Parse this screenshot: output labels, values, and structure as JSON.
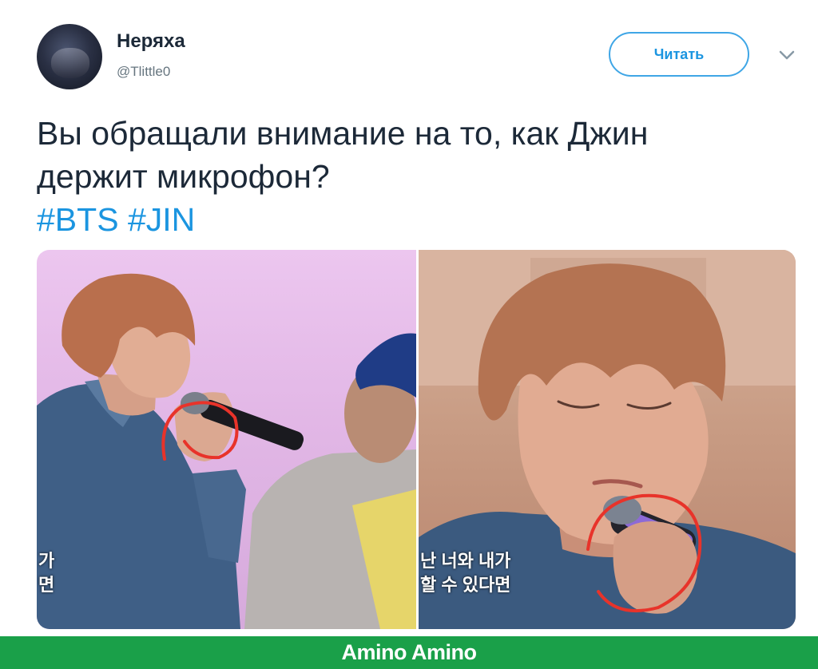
{
  "tweet": {
    "author_name": "Неряха",
    "author_handle": "@Tlittle0",
    "follow_label": "Читать",
    "text_line1": "Вы обращали внимание на то, как Джин",
    "text_line2": "держит микрофон?",
    "hashtags": [
      "#BTS",
      "#JIN"
    ]
  },
  "media": {
    "left_subtitle_line1": "가",
    "left_subtitle_line2": "면",
    "right_subtitle_line1": "난 너와 내가",
    "right_subtitle_line2": "할 수 있다면"
  },
  "footer": {
    "brand": "Amino Amino",
    "background_color": "#1aa049"
  },
  "colors": {
    "link": "#1b95e0",
    "text": "#1c2938",
    "annotation_circle": "#e8332a"
  },
  "icons": {
    "follow_menu": "chevron-down-icon"
  }
}
